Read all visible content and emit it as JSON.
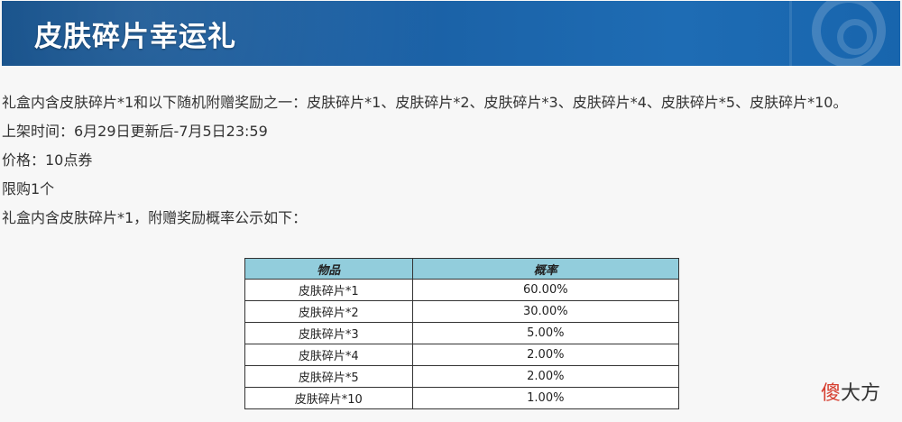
{
  "header": {
    "title": "皮肤碎片幸运礼"
  },
  "content": {
    "lines": [
      "礼盒内含皮肤碎片*1和以下随机附赠奖励之一：皮肤碎片*1、皮肤碎片*2、皮肤碎片*3、皮肤碎片*4、皮肤碎片*5、皮肤碎片*10。",
      "上架时间：6月29日更新后-7月5日23:59",
      "价格：10点券",
      "限购1个",
      "礼盒内含皮肤碎片*1，附赠奖励概率公示如下："
    ]
  },
  "table": {
    "headers": [
      "物品",
      "概率"
    ],
    "rows": [
      [
        "皮肤碎片*1",
        "60.00%"
      ],
      [
        "皮肤碎片*2",
        "30.00%"
      ],
      [
        "皮肤碎片*3",
        "5.00%"
      ],
      [
        "皮肤碎片*4",
        "2.00%"
      ],
      [
        "皮肤碎片*5",
        "2.00%"
      ],
      [
        "皮肤碎片*10",
        "1.00%"
      ]
    ]
  },
  "watermark": {
    "first_char": "傻",
    "rest": "大方"
  },
  "colors": {
    "banner": "#1a5fa3",
    "table_header": "#92cddc",
    "watermark_accent": "#d63d2e"
  }
}
